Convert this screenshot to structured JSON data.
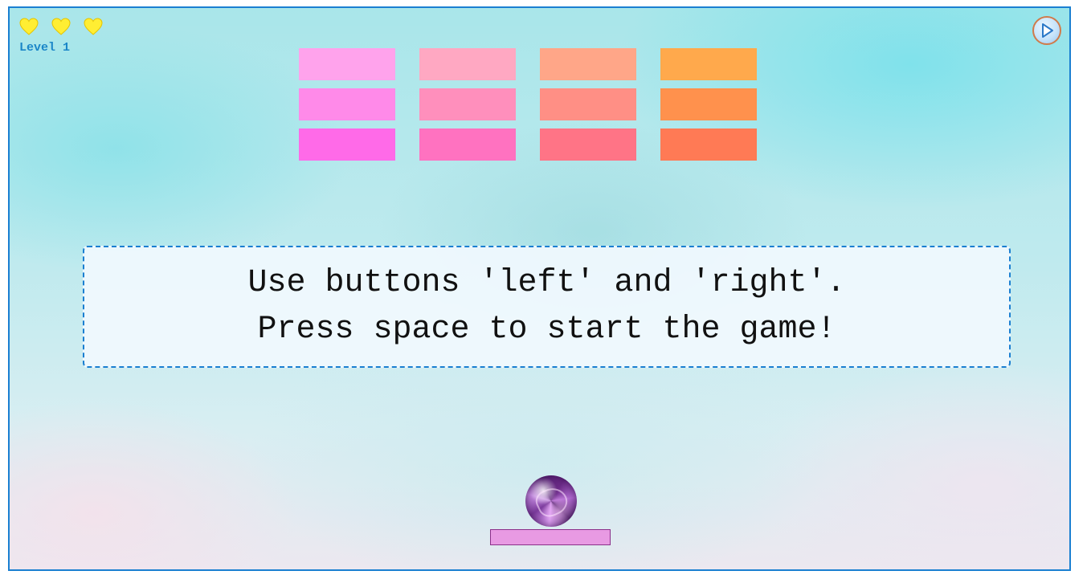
{
  "hud": {
    "lives": 3,
    "heart_icon": "heart-icon",
    "heart_color": "#ffee33",
    "level_label": "Level 1",
    "play_icon": "play-icon"
  },
  "bricks": {
    "rows": 3,
    "columns": 4,
    "colors": [
      [
        "#ffa3ec",
        "#ffa8c2",
        "#ffa688",
        "#ffa94c"
      ],
      [
        "#ff8ae9",
        "#ff8fbc",
        "#ff8f85",
        "#ff914d"
      ],
      [
        "#ff6ae8",
        "#ff72c0",
        "#ff7486",
        "#ff7a55"
      ]
    ]
  },
  "message": {
    "line1": "Use buttons 'left' and 'right'.",
    "line2": "Press space to start the game!"
  },
  "ball": {
    "icon": "ball-icon"
  },
  "paddle": {
    "color": "#e89ae3"
  },
  "theme": {
    "border_color": "#1a7fd1",
    "level_color": "#1a86c8"
  }
}
